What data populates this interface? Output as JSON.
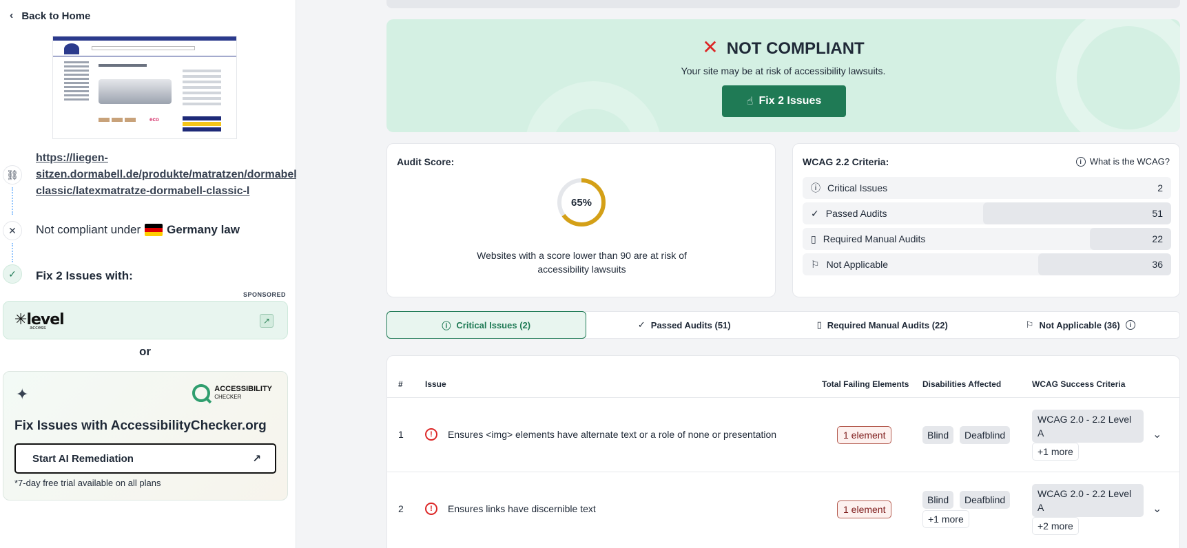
{
  "sidebar": {
    "back_label": "Back to Home",
    "url": "https://liegen-sitzen.dormabell.de/produkte/matratzen/dormabell-classic/latexmatratze-dormabell-classic-l",
    "url_line1": "https://liegen-",
    "url_line2": "sitzen.dormabell.de/produkte/matratzen/dormabell-",
    "url_line3": "classic/latexmatratze-dormabell-classic-l",
    "compliance_text": "Not compliant under",
    "law": "Germany law",
    "fix_with": "Fix 2 Issues with:",
    "sponsored": "SPONSORED",
    "level_logo": "level",
    "level_logo_sub": "access",
    "or": "or",
    "ac_logo_title": "ACCESSIBILITY",
    "ac_logo_sub": "CHECKER",
    "ac_title": "Fix Issues with AccessibilityChecker.org",
    "ac_button": "Start AI Remediation",
    "ac_note": "*7-day free trial available on all plans",
    "thumb_eco": "eco",
    "flag_colors": [
      "#000000",
      "#dd0000",
      "#ffce00"
    ]
  },
  "banner": {
    "status": "NOT COMPLIANT",
    "subtitle": "Your site may be at risk of accessibility lawsuits.",
    "fix_button": "Fix 2 Issues"
  },
  "audit": {
    "label": "Audit Score:",
    "score": 0.65,
    "score_text": "65%",
    "warning": "Websites with a score lower than 90 are at risk of accessibility lawsuits",
    "accent": "#d4a017"
  },
  "wcag": {
    "label": "WCAG 2.2 Criteria:",
    "what_link": "What is the WCAG?",
    "rows": [
      {
        "icon": "alert-circle-icon",
        "label": "Critical Issues",
        "count": "2",
        "share": 0
      },
      {
        "icon": "check-icon",
        "label": "Passed Audits",
        "count": "51",
        "share": 0.51
      },
      {
        "icon": "document-icon",
        "label": "Required Manual Audits",
        "count": "22",
        "share": 0.22
      },
      {
        "icon": "flag-icon",
        "label": "Not Applicable",
        "count": "36",
        "share": 0.36
      }
    ]
  },
  "tabs": [
    {
      "label": "Critical Issues (2)",
      "icon": "alert-circle-icon",
      "active": true
    },
    {
      "label": "Passed Audits (51)",
      "icon": "check-icon"
    },
    {
      "label": "Required Manual Audits (22)",
      "icon": "document-icon"
    },
    {
      "label": "Not Applicable (36)",
      "icon": "flag-icon"
    }
  ],
  "table": {
    "headers": [
      "#",
      "Issue",
      "Total Failing Elements",
      "Disabilities Affected",
      "WCAG Success Criteria"
    ],
    "rows": [
      {
        "num": "1",
        "issue": "Ensures <img> elements have alternate text or a role of none or presentation",
        "elements": "1 element",
        "disabilities": [
          "Blind",
          "Deafblind"
        ],
        "criteria": "WCAG 2.0 - 2.2 Level A",
        "criteria_more": "+1 more"
      },
      {
        "num": "2",
        "issue": "Ensures links have discernible text",
        "elements": "1 element",
        "disabilities": [
          "Blind",
          "Deafblind"
        ],
        "disabilities_more": "+1 more",
        "criteria": "WCAG 2.0 - 2.2 Level A",
        "criteria_more": "+2 more"
      }
    ]
  },
  "colors": {
    "brand_green": "#1f7a55",
    "error_red": "#dc2626",
    "banner_bg": "#d4f0e3"
  }
}
